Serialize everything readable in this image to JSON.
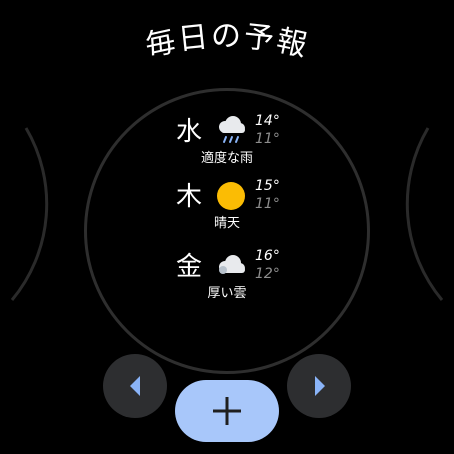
{
  "title": "毎日の予報",
  "forecast": [
    {
      "day": "水",
      "icon": "rain-cloud-icon",
      "high": "14°",
      "low": "11°",
      "condition": "適度な雨"
    },
    {
      "day": "木",
      "icon": "sun-icon",
      "high": "15°",
      "low": "11°",
      "condition": "晴天"
    },
    {
      "day": "金",
      "icon": "cloudy-icon",
      "high": "16°",
      "low": "12°",
      "condition": "厚い雲"
    }
  ],
  "controls": {
    "prev_icon": "chevron-left-icon",
    "next_icon": "chevron-right-icon",
    "add_icon": "plus-icon"
  },
  "colors": {
    "background": "#000000",
    "button_bg": "#2d2e30",
    "accent": "#a8c7fa",
    "arrow": "#8ab4f8",
    "sun": "#fbbc04",
    "low_temp": "#8d8d8d"
  }
}
